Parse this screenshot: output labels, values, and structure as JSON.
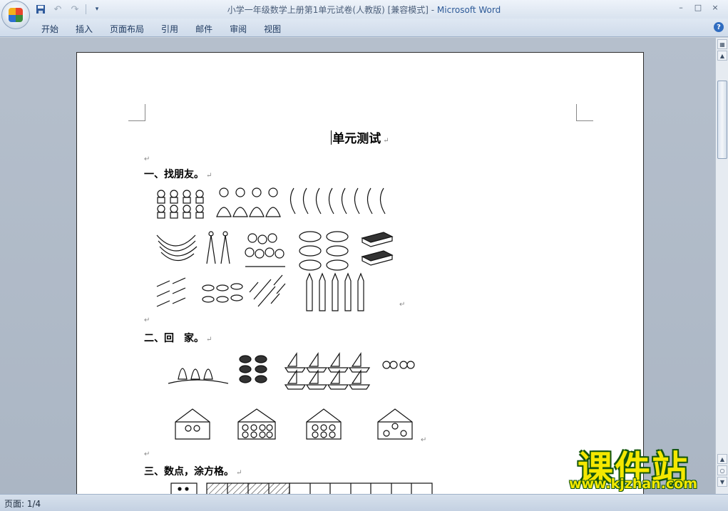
{
  "window": {
    "title": "小学一年级数学上册第1单元试卷(人教版) [兼容模式] - ",
    "app_name": "Microsoft Word",
    "controls": [
      "–",
      "□",
      "×"
    ]
  },
  "quick_access": {
    "save_icon": "save-icon",
    "undo_icon": "undo-icon",
    "redo_icon": "redo-icon"
  },
  "ribbon": {
    "tabs": [
      "开始",
      "插入",
      "页面布局",
      "引用",
      "邮件",
      "审阅",
      "视图"
    ],
    "help": "?"
  },
  "document": {
    "title": "单元测试",
    "paragraph_mark": "↵",
    "sections": [
      {
        "heading": "一、找朋友。"
      },
      {
        "heading": "二、回　家。"
      },
      {
        "heading": "三、数点，涂方格。"
      }
    ]
  },
  "statusbar": {
    "page_info": "页面: 1/4"
  },
  "watermark": {
    "text": "课件站",
    "url": "www.kjzhan.com"
  },
  "colors": {
    "ribbon_bg": "#dfe8f3",
    "page_bg": "#ffffff",
    "watermark_fill": "#f4e800",
    "watermark_stroke": "#16570f"
  }
}
